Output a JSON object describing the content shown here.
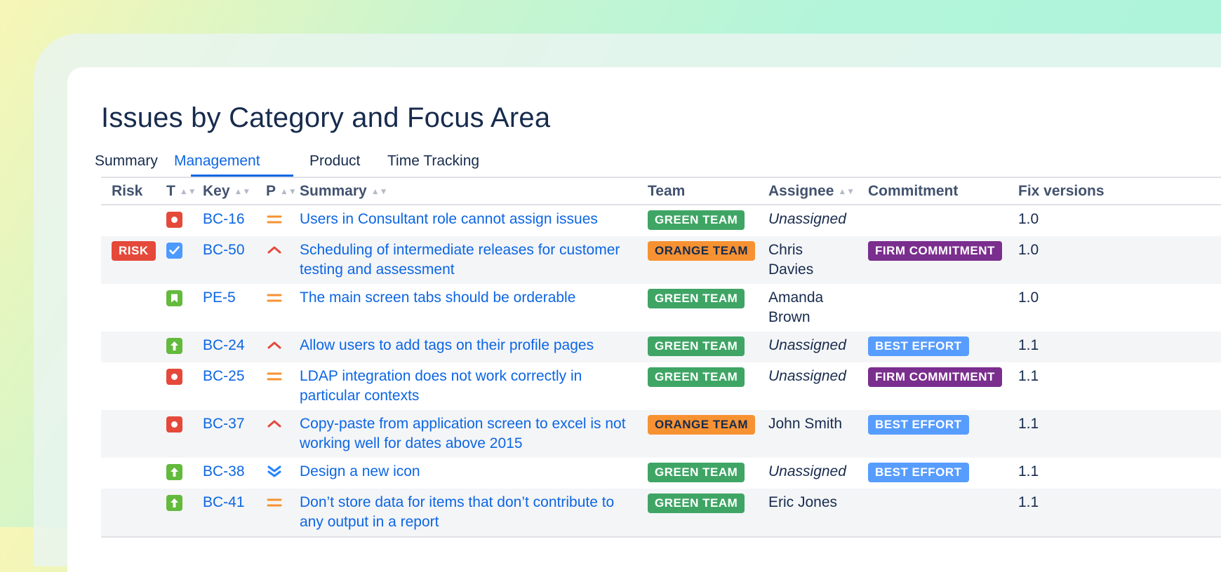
{
  "title": "Issues by Category and Focus Area",
  "tabs": [
    {
      "label": "Summary",
      "active": false
    },
    {
      "label": "Management",
      "active": true
    },
    {
      "label": "Product",
      "active": false
    },
    {
      "label": "Time Tracking",
      "active": false
    }
  ],
  "columns": {
    "risk": "Risk",
    "type": "T",
    "key": "Key",
    "priority": "P",
    "summary": "Summary",
    "team": "Team",
    "assignee": "Assignee",
    "commitment": "Commitment",
    "fix_versions": "Fix versions"
  },
  "colors": {
    "link": "#0c66e4",
    "green_team": "#3fa565",
    "orange_team": "#f79232",
    "firm_commitment": "#7a2e8d",
    "best_effort": "#579dff",
    "risk": "#e5493a"
  },
  "rows": [
    {
      "risk": "",
      "type": "bug-icon",
      "key": "BC-16",
      "priority": "medium-priority-icon",
      "summary": "Users in Consultant role cannot assign issues",
      "team": "GREEN TEAM",
      "assignee": "Unassigned",
      "commitment": "",
      "fix_version": "1.0"
    },
    {
      "risk": "RISK",
      "type": "task-icon",
      "key": "BC-50",
      "priority": "high-priority-icon",
      "summary": "Scheduling of intermediate releases for customer testing and assessment",
      "team": "ORANGE TEAM",
      "assignee": "Chris Davies",
      "commitment": "FIRM COMMITMENT",
      "fix_version": "1.0"
    },
    {
      "risk": "",
      "type": "story-icon",
      "key": "PE-5",
      "priority": "medium-priority-icon",
      "summary": "The main screen tabs should be orderable",
      "team": "GREEN TEAM",
      "assignee": "Amanda Brown",
      "commitment": "",
      "fix_version": "1.0"
    },
    {
      "risk": "",
      "type": "improvement-icon",
      "key": "BC-24",
      "priority": "high-priority-icon",
      "summary": "Allow users to add tags on their profile pages",
      "team": "GREEN TEAM",
      "assignee": "Unassigned",
      "commitment": "BEST EFFORT",
      "fix_version": "1.1"
    },
    {
      "risk": "",
      "type": "bug-icon",
      "key": "BC-25",
      "priority": "medium-priority-icon",
      "summary": "LDAP integration does not work correctly in particular contexts",
      "team": "GREEN TEAM",
      "assignee": "Unassigned",
      "commitment": "FIRM COMMITMENT",
      "fix_version": "1.1"
    },
    {
      "risk": "",
      "type": "bug-icon",
      "key": "BC-37",
      "priority": "high-priority-icon",
      "summary": "Copy-paste from application screen to excel is not working well for dates above 2015",
      "team": "ORANGE TEAM",
      "assignee": "John Smith",
      "commitment": "BEST EFFORT",
      "fix_version": "1.1"
    },
    {
      "risk": "",
      "type": "improvement-icon",
      "key": "BC-38",
      "priority": "lowest-priority-icon",
      "summary": "Design a new icon",
      "team": "GREEN TEAM",
      "assignee": "Unassigned",
      "commitment": "BEST EFFORT",
      "fix_version": "1.1"
    },
    {
      "risk": "",
      "type": "improvement-icon",
      "key": "BC-41",
      "priority": "medium-priority-icon",
      "summary": "Don’t store data for items that don’t contribute to any output in a report",
      "team": "GREEN TEAM",
      "assignee": "Eric Jones",
      "commitment": "",
      "fix_version": "1.1"
    }
  ]
}
